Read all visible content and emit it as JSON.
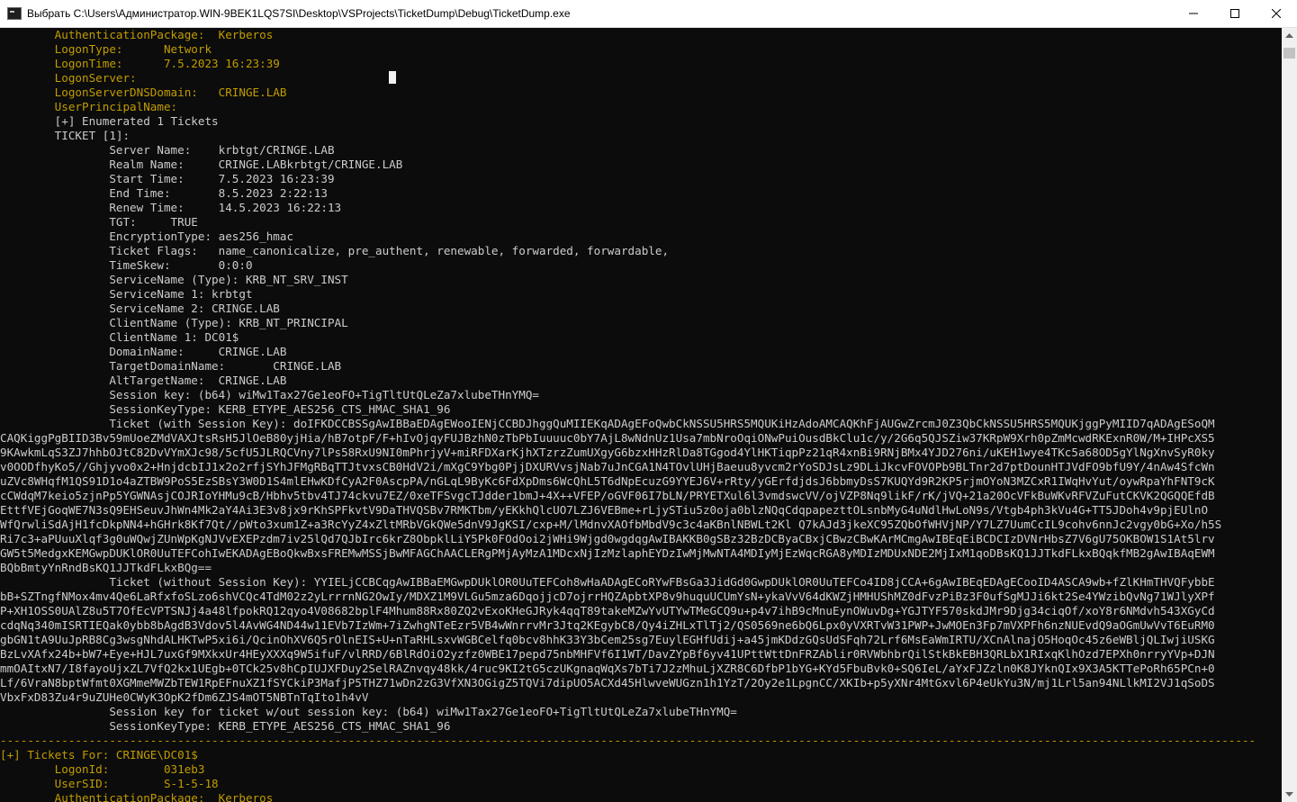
{
  "window": {
    "title": "Выбрать C:\\Users\\Администратор.WIN-9BEK1LQS7SI\\Desktop\\VSProjects\\TicketDump\\Debug\\TicketDump.exe",
    "controls": {
      "minimize": "minimize-icon",
      "maximize": "maximize-icon",
      "close": "close-icon"
    }
  },
  "colors": {
    "default_text": "#cccccc",
    "highlight_text": "#c19c00",
    "background": "#0c0c0c"
  },
  "console_lines": [
    {
      "text": "        AuthenticationPackage:  Kerberos",
      "style": "y"
    },
    {
      "text": "        LogonType:      Network",
      "style": "y"
    },
    {
      "text": "        LogonTime:      7.5.2023 16:23:39",
      "style": "y"
    },
    {
      "text": "        LogonServer:",
      "style": "y"
    },
    {
      "text": "        LogonServerDNSDomain:   CRINGE.LAB",
      "style": "y"
    },
    {
      "text": "        UserPrincipalName:",
      "style": "y"
    },
    {
      "text": "        [+] Enumerated 1 Tickets",
      "style": "w"
    },
    {
      "text": "        TICKET [1]:",
      "style": "w"
    },
    {
      "text": "                Server Name:    krbtgt/CRINGE.LAB",
      "style": "w"
    },
    {
      "text": "                Realm Name:     CRINGE.LABkrbtgt/CRINGE.LAB",
      "style": "w"
    },
    {
      "text": "                Start Time:     7.5.2023 16:23:39",
      "style": "w"
    },
    {
      "text": "                End Time:       8.5.2023 2:22:13",
      "style": "w"
    },
    {
      "text": "                Renew Time:     14.5.2023 16:22:13",
      "style": "w"
    },
    {
      "text": "                TGT:     TRUE",
      "style": "w"
    },
    {
      "text": "                EncryptionType: aes256_hmac",
      "style": "w"
    },
    {
      "text": "                Ticket Flags:   name_canonicalize, pre_authent, renewable, forwarded, forwardable,",
      "style": "w"
    },
    {
      "text": "                TimeSkew:       0:0:0",
      "style": "w"
    },
    {
      "text": "                ServiceName (Type): KRB_NT_SRV_INST",
      "style": "w"
    },
    {
      "text": "                ServiceName 1: krbtgt",
      "style": "w"
    },
    {
      "text": "                ServiceName 2: CRINGE.LAB",
      "style": "w"
    },
    {
      "text": "                ClientName (Type): KRB_NT_PRINCIPAL",
      "style": "w"
    },
    {
      "text": "                ClientName 1: DC01$",
      "style": "w"
    },
    {
      "text": "                DomainName:     CRINGE.LAB",
      "style": "w"
    },
    {
      "text": "                TargetDomainName:       CRINGE.LAB",
      "style": "w"
    },
    {
      "text": "                AltTargetName:  CRINGE.LAB",
      "style": "w"
    },
    {
      "text": "                Session key: (b64) wiMw1Tax27Ge1eoFO+TigTltUtQLeZa7xlubeTHnYMQ=",
      "style": "w"
    },
    {
      "text": "                SessionKeyType: KERB_ETYPE_AES256_CTS_HMAC_SHA1_96",
      "style": "w"
    },
    {
      "text": "                Ticket (with Session Key): doIFKDCCBSSgAwIBBaEDAgEWooIENjCCBDJhggQuMIIEKqADAgEFoQwbCkNSSU5HRS5MQUKiHzAdoAMCAQKhFjAUGwZrcmJ0Z3QbCkNSSU5HRS5MQUKjggPyMIID7qADAgESoQM",
      "style": "w"
    },
    {
      "text": "CAQKiggPgBIID3Bv59mUoeZMdVAXJtsRsH5JlOeB80yjHia/hB7otpF/F+hIvOjqyFUJBzhN0zTbPbIuuuuc0bY7AjL8wNdnUz1Usa7mbNroOqiONwPuiOusdBkClu1c/y/2G6q5QJSZiw37KRpW9Xrh0pZmMcwdRKExnR0W/M+IHPcXS5",
      "style": "w"
    },
    {
      "text": "9KAwkmLqS3ZJ7hhbOJtC82DvVYmXJc98/5cfU5JLRQCVny7lPs58RxU9NI0mPhrjyV+miRFDXarKjhXTzrzZumUXgyG6bzxHHzRlDa8TGgod4YlHKTiqpPz21qR4xnBi9RNjBMx4YJD276ni/uKEH1wye4TKc5a68OD5gYlNgXnvSyR0ky",
      "style": "w"
    },
    {
      "text": "v0OODfhyKo5//Ghjyvo0x2+HnjdcbIJ1x2o2rfjSYhJFMgRBqTTJtvxsCB0HdV2i/mXgC9Ybg0PjjDXURVvsjNab7uJnCGA1N4TOvlUHjBaeuu8yvcm2rYoSDJsLz9DLiJkcvFOVOPb9BLTnr2d7ptDounHTJVdFO9bfU9Y/4nAw4SfcWn",
      "style": "w"
    },
    {
      "text": "uZVc8WHqfM1QS91D1o4aZTBW9PoS5EzSBsY3W0D1S4mlEHwKDfCyA2F0AscpPA/nGLqL9ByKc6FdXpDms6WcQhL5T6dNpEcuzG9YYEJ6V+rRty/yGErfdjdsJ6bbmyDsS7KUQYd9R2KP5rjmOYoN3MZCxR1IWqHvYut/oywRpaYhFNT9cK",
      "style": "w"
    },
    {
      "text": "cCWdqM7keio5zjnPp5YGWNAsjCOJRIoYHMu9cB/Hbhv5tbv4TJ74ckvu7EZ/0xeTFSvgcTJdder1bmJ+4X++VFEP/oGVF06I7bLN/PRYETXul6l3vmdswcVV/ojVZP8Nq9likF/rK/jVQ+21a20OcVFkBuWKvRFVZuFutCKVK2QGQQEfdB",
      "style": "w"
    },
    {
      "text": "EttfVEjGoqWE7N3sQ9EHSeuvJhWn4Mk2aY4Ai3E3v8jx9rKhSPFkvtV9DaTHVQSBv7RMKTbm/yEKkhQlcUO7LZJ6VEBme+rLjySTiu5z0oja0blzNQqCdqpapezttOLsnbMyG4uNdlHwLoN9s/Vtgb4ph3kVu4G+TT5JDoh4v9pjEUlnO",
      "style": "w"
    },
    {
      "text": "WfQrwliSdAjH1fcDkpNN4+hGHrk8Kf7Qt//pWto3xum1Z+a3RcYyZ4xZltMRbVGkQWe5dnV9JgKSI/cxp+M/lMdnvXAOfbMbdV9c3c4aKBnlNBWLt2Kl Q7kAJd3jkeXC95ZQbOfWHVjNP/Y7LZ7UumCcIL9cohv6nnJc2vgy0bG+Xo/h5S",
      "style": "w"
    },
    {
      "text": "Ri7c3+aPUuuXlqf3g0uWQwjZUnWpKgNJVvEXEPzdm7iv25lQd7QJbIrc6krZ8ObpklLiY5Pk0FOdOoi2jWHi9Wjgd0wgdqgAwIBAKKB0gSBz32BzDCByaCBxjCBwzCBwKArMCmgAwIBEqEiBCDCIzDVNrHbsZ7V6gU75OKBOW1S1At5lrv",
      "style": "w"
    },
    {
      "text": "GW5t5MedgxKEMGwpDUKlOR0UuTEFCohIwEKADAgEBoQkwBxsFREMwMSSjBwMFAGChAACLERgPMjAyMzA1MDcxNjIzMzlaphEYDzIwMjMwNTA4MDIyMjEzWqcRGA8yMDIzMDUxNDE2MjIxM1qoDBsKQ1JJTkdFLkxBQqkfMB2gAwIBAqEWM",
      "style": "w"
    },
    {
      "text": "BQbBmtyYnRndBsKQ1JJTkdFLkxBQg==",
      "style": "w"
    },
    {
      "text": "                Ticket (without Session Key): YYIELjCCBCqgAwIBBaEMGwpDUklOR0UuTEFCoh8wHaADAgECoRYwFBsGa3JidGd0GwpDUklOR0UuTEFCo4ID8jCCA+6gAwIBEqEDAgECooID4ASCA9wb+fZlKHmTHVQFybbE",
      "style": "w"
    },
    {
      "text": "bB+SZTngfNMox4mv4Qe6LaRfxfoSLzo6shVCQc4TdM02z2yLrrrnNG2OwIy/MDXZ1M9VLGu5mza6DqojjcD7ojrrHQZApbtXP8v9huquUCUmYsN+ykaVvV64dKWZjHMHUShMZ0dFvzPiBz3F0ufSgMJJi6kt2Se4YWzibQvNg71WJlyXPf",
      "style": "w"
    },
    {
      "text": "P+XH1OSS0UAlZ8u5T7OfEcVPTSNJj4a48lfpokRQ12qyo4V08682bplF4Mhum88Rx80ZQ2vExoKHeGJRyk4qqT89takeMZwYvUTYwTMeGCQ9u+p4v7ihB9cMnuEynOWuvDg+YGJTYF570skdJMr9Djg34ciqOf/xoY8r6NMdvh543XGyCd",
      "style": "w"
    },
    {
      "text": "cdqNq340mISRTIEQak0ybb8bAgdB3Vdov5l4AvWG4ND44w11EVb7IzWm+7iZwhgNTeEzr5VB4wWnrrvMr3Jtq2KEgybC8/Qy4iZHLxTlTj2/QS0569ne6bQ6Lpx0yVXRTvW31PWP+JwMOEn3Fp7mVXPFh6nzNUEvdQ9aOGmUwVvT6EuRM0",
      "style": "w"
    },
    {
      "text": "gbGN1tA9UuJpRB8Cg3wsgNhdALHKTwP5xi6i/QcinOhXV6Q5rOlnEIS+U+nTaRHLsxvWGBCelfq0bcv8hhK33Y3bCem25sg7EuylEGHfUdij+a45jmKDdzGQsUdSFqh72Lrf6MsEaWmIRTU/XCnAlnajO5HoqOc45z6eWBljQLIwjiUSKG",
      "style": "w"
    },
    {
      "text": "BzLvXAfx24b+bW7+Eye+HJL7uxGf9MXkxUr4HEyXXXq9W5ifuF/vlRRD/6BlRdOiO2yzfz0WBE17pepd75nbMHFVf6I1WT/DavZYpBf6yv41UPttWttDnFRZAblir0RVWbhbrQilStkBkEBH3QRLbX1RIxqKlhOzd7EPXh0nrryYVp+DJN",
      "style": "w"
    },
    {
      "text": "mmOAItxN7/I8fayoUjxZL7VfQ2kx1UEgb+0TCk25v8hCpIUJXFDuy2SelRAZnvqy48kk/4ruc9KI2tG5czUKgnaqWqXs7bTi7J2zMhuLjXZR8C6DfbP1bYG+KYd5FbuBvk0+SQ6IeL/aYxFJZzln0K8JYknQIx9X3A5KTTePoRh65PCn+0",
      "style": "w"
    },
    {
      "text": "Lf/6VraN8bptWfmt0XGMmeMWZbTEW1RpEFnuXZ1fSYCkiP3MafjP5THZ71wDn2zG3VfXN3OGigZ5TQVi7dipUO5ACXd45HlwveWUGzn1h1YzT/2Oy2e1LpgnCC/XKIb+p5yXNr4MtGxvl6P4eUkYu3N/mj1Lrl5an94NLlkMI2VJ1qSoDS",
      "style": "w"
    },
    {
      "text": "VbxFxD83Zu4r9uZUHe0CWyK3OpK2fDm6ZJS4mOT5NBTnTqIto1h4vV",
      "style": "w"
    },
    {
      "text": "                Session key for ticket w/out session key: (b64) wiMw1Tax27Ge1eoFO+TigTltUtQLeZa7xlubeTHnYMQ=",
      "style": "w"
    },
    {
      "text": "                SessionKeyType: KERB_ETYPE_AES256_CTS_HMAC_SHA1_96",
      "style": "w"
    },
    {
      "text": "----------------------------------------------------------------------------------------------------------------------------------------------------------------------------------------",
      "style": "y"
    },
    {
      "text": "[+] Tickets For: CRINGE\\DC01$",
      "style": "y"
    },
    {
      "text": "        LogonId:        031eb3",
      "style": "y"
    },
    {
      "text": "        UserSID:        S-1-5-18",
      "style": "y"
    },
    {
      "text": "        AuthenticationPackage:  Kerberos",
      "style": "y"
    }
  ],
  "scrollbar": {
    "up_icon": "scroll-up-arrow-icon",
    "down_icon": "scroll-down-arrow-icon"
  }
}
